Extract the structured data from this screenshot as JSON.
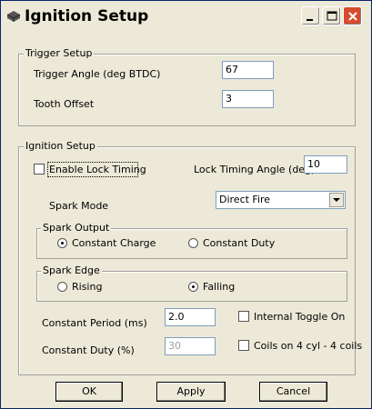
{
  "window": {
    "title": "Ignition Setup"
  },
  "trigger_setup": {
    "group_label": "Trigger Setup",
    "trigger_angle_label": "Trigger Angle (deg BTDC)",
    "trigger_angle_value": "67",
    "tooth_offset_label": "Tooth Offset",
    "tooth_offset_value": "3"
  },
  "ignition_setup": {
    "group_label": "Ignition Setup",
    "enable_lock_timing_label": "Enable Lock Timing",
    "enable_lock_timing_checked": false,
    "lock_timing_angle_label": "Lock Timing Angle (deg)",
    "lock_timing_angle_value": "10",
    "spark_mode_label": "Spark Mode",
    "spark_mode_value": "Direct Fire",
    "spark_output": {
      "group_label": "Spark Output",
      "option_constant_charge": "Constant Charge",
      "option_constant_duty": "Constant Duty",
      "selected": "Constant Charge"
    },
    "spark_edge": {
      "group_label": "Spark Edge",
      "option_rising": "Rising",
      "option_falling": "Falling",
      "selected": "Falling"
    },
    "constant_period_label": "Constant Period (ms)",
    "constant_period_value": "2.0",
    "constant_duty_label": "Constant Duty (%)",
    "constant_duty_value": "30",
    "internal_toggle_label": "Internal Toggle On",
    "internal_toggle_checked": false,
    "coils_label": "Coils on 4 cyl - 4 coils",
    "coils_checked": false
  },
  "buttons": {
    "ok": "OK",
    "apply": "Apply",
    "cancel": "Cancel"
  },
  "colors": {
    "window_bg": "#ece9d8",
    "close_button": "#d74b2e",
    "input_border": "#7f9db9"
  }
}
